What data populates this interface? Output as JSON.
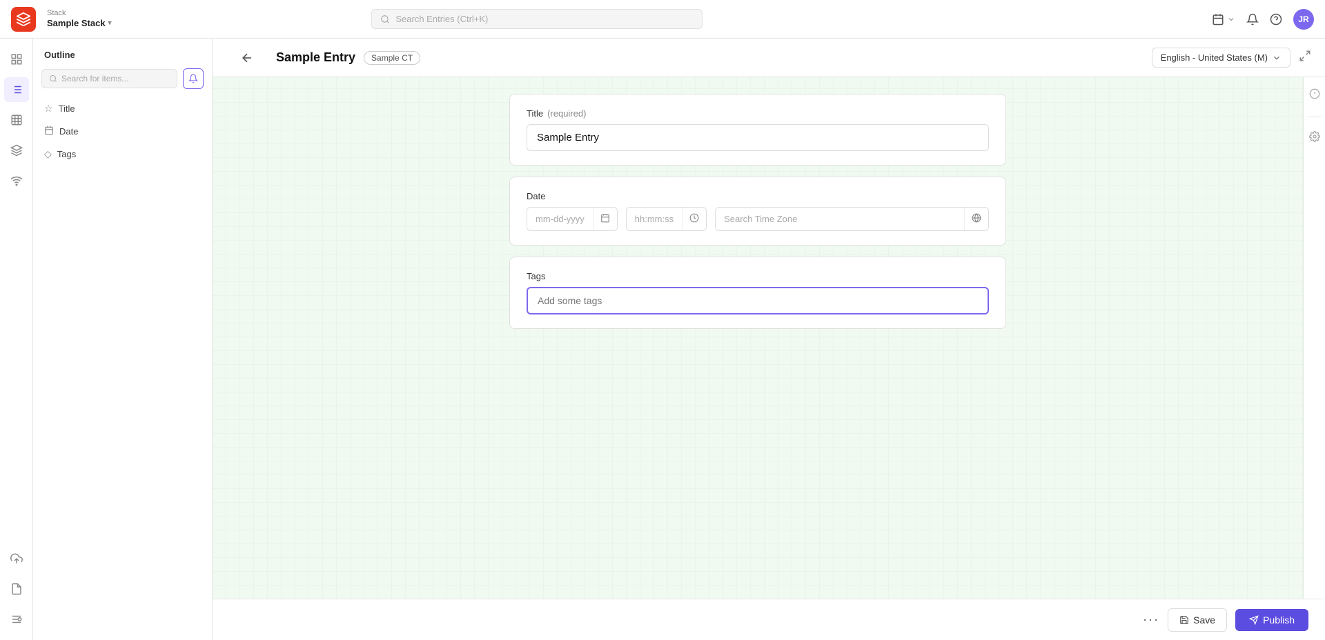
{
  "topbar": {
    "stack_label": "Stack",
    "stack_name": "Sample Stack",
    "search_placeholder": "Search Entries (Ctrl+K)",
    "user_initials": "JR",
    "calendar_icon": "📅"
  },
  "nav_icons": [
    {
      "name": "dashboard-icon",
      "symbol": "⊞",
      "active": false
    },
    {
      "name": "list-icon",
      "symbol": "☰",
      "active": true
    },
    {
      "name": "grid-icon",
      "symbol": "⊡",
      "active": false
    },
    {
      "name": "layers-icon",
      "symbol": "◫",
      "active": false
    },
    {
      "name": "wifi-icon",
      "symbol": "◉",
      "active": false
    },
    {
      "name": "upload-icon",
      "symbol": "↑",
      "active": false
    },
    {
      "name": "document-icon",
      "symbol": "⊟",
      "active": false
    },
    {
      "name": "settings-icon",
      "symbol": "⚙",
      "active": false
    }
  ],
  "outline": {
    "title": "Outline",
    "search_placeholder": "Search for items...",
    "items": [
      {
        "label": "Title",
        "icon": "☆"
      },
      {
        "label": "Date",
        "icon": "⊞"
      },
      {
        "label": "Tags",
        "icon": "◇"
      }
    ]
  },
  "entry": {
    "back_label": "←",
    "title": "Sample Entry",
    "ct_badge": "Sample CT",
    "locale": "English - United States (M)",
    "fullscreen_icon": "⤢"
  },
  "form": {
    "title_section": {
      "label": "Title",
      "required_text": "(required)",
      "value": "Sample Entry",
      "placeholder": "Sample Entry"
    },
    "date_section": {
      "label": "Date",
      "date_placeholder": "mm-dd-yyyy",
      "time_placeholder": "hh:mm:ss",
      "timezone_placeholder": "Search Time Zone"
    },
    "tags_section": {
      "label": "Tags",
      "placeholder": "Add some tags"
    }
  },
  "bottom_bar": {
    "more_label": "···",
    "save_label": "Save",
    "publish_label": "Publish"
  },
  "right_panel": {
    "info_icon": "ℹ",
    "settings_icon": "◎"
  }
}
